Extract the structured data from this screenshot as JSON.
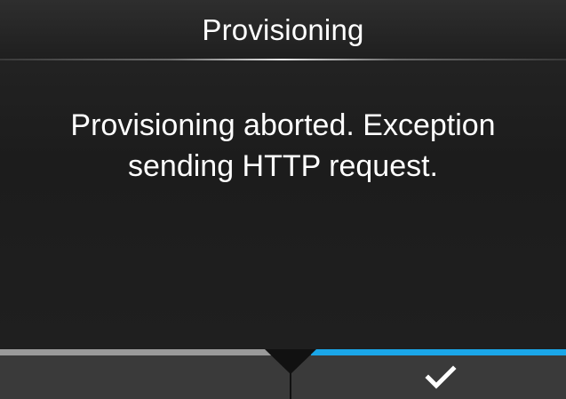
{
  "header": {
    "title": "Provisioning"
  },
  "dialog": {
    "message": "Provisioning aborted. Exception sending HTTP request."
  },
  "softkeys": {
    "left": {
      "label": ""
    },
    "right": {
      "icon": "checkmark-icon"
    }
  },
  "colors": {
    "background": "#1e1e1e",
    "softkey_background": "#3a3a3a",
    "left_indicator": "#9a9a9a",
    "right_indicator": "#1aa6e8"
  }
}
